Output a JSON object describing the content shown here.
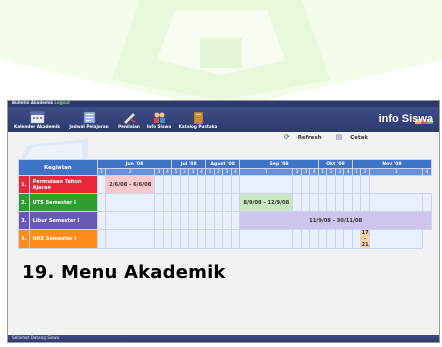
{
  "window": {
    "title_prefix": "Bulletin Akademik",
    "title_link": "Logout"
  },
  "toolbar": {
    "items": [
      {
        "label": "Kalender Akademik",
        "icon": "calendar-icon"
      },
      {
        "label": "Jadwal Pelajaran",
        "icon": "schedule-icon"
      },
      {
        "label": "Penilaian",
        "icon": "grading-icon"
      },
      {
        "label": "Info Siswa",
        "icon": "students-icon"
      },
      {
        "label": "Katalog Pustaka",
        "icon": "library-icon"
      }
    ],
    "brand": "info Siswa"
  },
  "actions": {
    "refresh_label": "Refresh",
    "print_label": "Cetak"
  },
  "calendar": {
    "activity_header": "Kegiatan",
    "months": [
      {
        "label": "Jun '08",
        "weeks": [
          "1",
          "2",
          "3",
          "4"
        ]
      },
      {
        "label": "Jul '08",
        "weeks": [
          "1",
          "2",
          "3",
          "4"
        ]
      },
      {
        "label": "Agust '08",
        "weeks": [
          "1",
          "2",
          "3",
          "4"
        ]
      },
      {
        "label": "Sep '08",
        "weeks": [
          "1",
          "2",
          "3",
          "4"
        ]
      },
      {
        "label": "Okt '08",
        "weeks": [
          "1",
          "2",
          "3",
          "4"
        ]
      },
      {
        "label": "Nov '08",
        "weeks": [
          "1",
          "2",
          "3",
          "4"
        ]
      }
    ],
    "rows": [
      {
        "no": "1.",
        "name": "Permulaan Tahun Ajaran",
        "color": "#e8283a",
        "event": "2/6/08 - 6/6/08",
        "event_color": "#f7c9cc"
      },
      {
        "no": "2.",
        "name": "UTS Semester I",
        "color": "#2ca02c",
        "event": "8/9/08 - 12/9/08",
        "event_color": "#c8e8c0"
      },
      {
        "no": "3.",
        "name": "Libur Semester I",
        "color": "#6a58b8",
        "event": "11/9/08 - 30/11/08",
        "event_color": "#cfc4ec"
      },
      {
        "no": "4.",
        "name": "UAS Semester I",
        "color": "#ff8c1a",
        "event": "17/11/08 - 21/11/08",
        "event_color": "#fbd3a6"
      }
    ]
  },
  "overlay_heading": "19. Menu Akademik",
  "status_bar": "Selamat Datang Siswa",
  "colors": {
    "toolbar": "#34427a",
    "header_blue": "#3e74c8",
    "watermark": "#e8f6d8"
  }
}
